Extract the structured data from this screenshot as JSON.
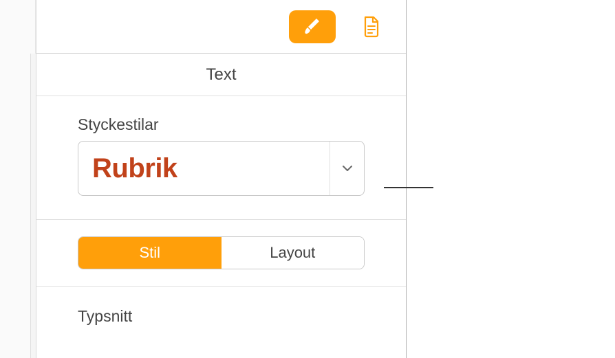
{
  "toolbar": {
    "format_icon": "brush-icon",
    "document_icon": "document-icon"
  },
  "inspector": {
    "header": "Text",
    "paragraph_styles_label": "Styckestilar",
    "selected_style": "Rubrik",
    "tabs": {
      "style": "Stil",
      "layout": "Layout"
    },
    "font_label": "Typsnitt"
  },
  "colors": {
    "accent": "#ff9f0a",
    "heading_style": "#c1421a"
  }
}
